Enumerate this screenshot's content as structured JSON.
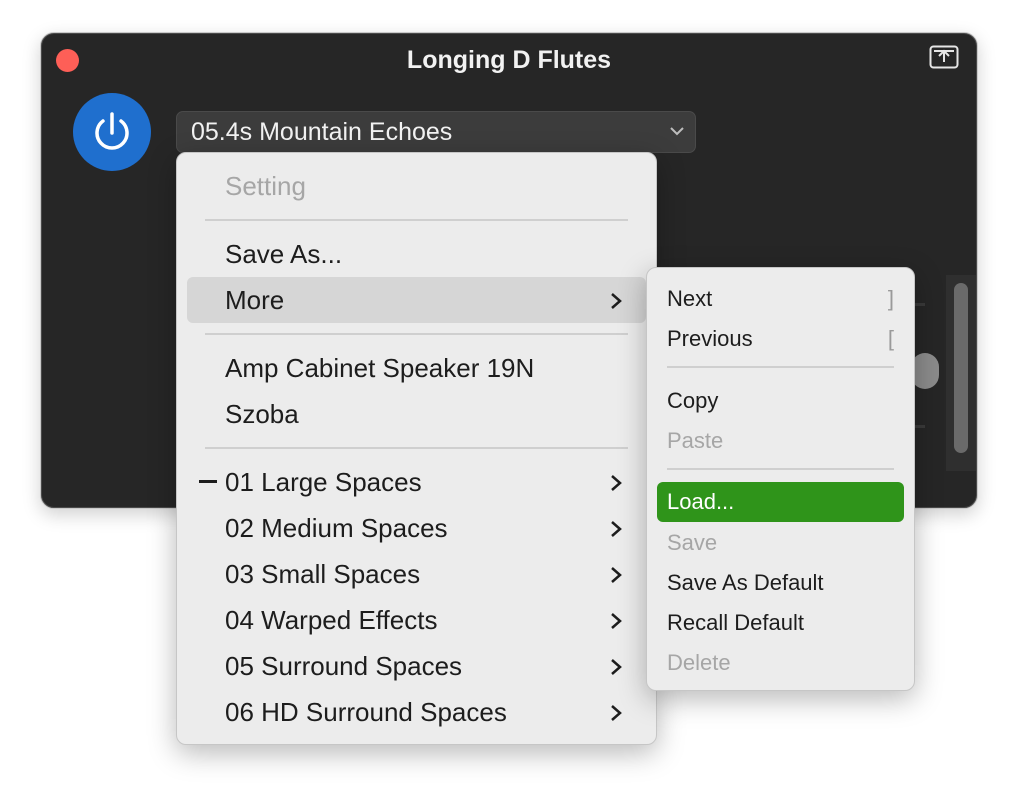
{
  "window": {
    "title": "Longing D Flutes"
  },
  "preset": {
    "current": "05.4s Mountain Echoes"
  },
  "main_menu": {
    "header": "Setting",
    "save_as": "Save As...",
    "more": "More",
    "recent": [
      "Amp Cabinet Speaker 19N",
      "Szoba"
    ],
    "folders": [
      "01 Large Spaces",
      "02 Medium Spaces",
      "03 Small Spaces",
      "04 Warped Effects",
      "05 Surround Spaces",
      "06 HD Surround Spaces"
    ]
  },
  "sub_menu": {
    "next": "Next",
    "next_shortcut": "]",
    "previous": "Previous",
    "previous_shortcut": "[",
    "copy": "Copy",
    "paste": "Paste",
    "load": "Load...",
    "save": "Save",
    "save_as_default": "Save As Default",
    "recall_default": "Recall Default",
    "delete": "Delete"
  },
  "colors": {
    "window_bg": "#262626",
    "power_blue": "#1f6fce",
    "close_red": "#fe5f57",
    "selection_green": "#2f941a"
  },
  "icons": {
    "close": "close-icon",
    "export": "export-icon",
    "power": "power-icon",
    "dropdown": "chevron-down-icon",
    "submenu": "chevron-right-icon"
  }
}
